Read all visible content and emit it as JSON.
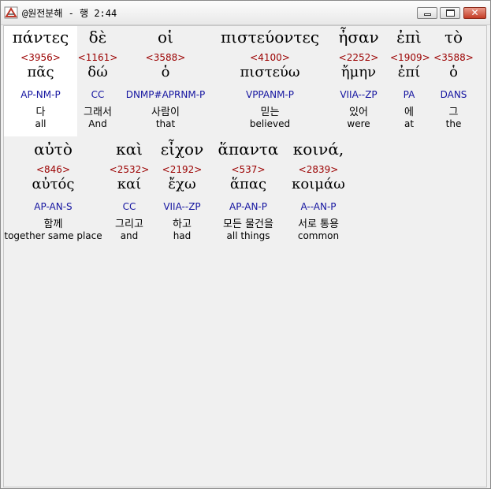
{
  "window": {
    "title": "@원전분해 - 행 2:44",
    "buttons": {
      "minimize": "_",
      "maximize": "□",
      "close": "✕"
    },
    "icon": "book-pen-icon"
  },
  "words": [
    {
      "greek": "πάντες",
      "strong": "<3956>",
      "lemma": "πᾶς",
      "morph": "AP-NM-P",
      "korean": "다",
      "english": "all",
      "selected": true
    },
    {
      "greek": "δὲ",
      "strong": "<1161>",
      "lemma": "δώ",
      "morph": "CC",
      "korean": "그래서",
      "english": "And"
    },
    {
      "greek": "οἱ",
      "strong": "<3588>",
      "lemma": "ὁ",
      "morph": "DNMP#APRNM-P",
      "korean": "사람이",
      "english": "that"
    },
    {
      "greek": "πιστεύοντες",
      "strong": "<4100>",
      "lemma": "πιστεύω",
      "morph": "VPPANM-P",
      "korean": "믿는",
      "english": "believed"
    },
    {
      "greek": "ἦσαν",
      "strong": "<2252>",
      "lemma": "ἤμην",
      "morph": "VIIA--ZP",
      "korean": "있어",
      "english": "were"
    },
    {
      "greek": "ἐπὶ",
      "strong": "<1909>",
      "lemma": "ἐπί",
      "morph": "PA",
      "korean": "에",
      "english": "at"
    },
    {
      "greek": "τὸ",
      "strong": "<3588>",
      "lemma": "ὁ",
      "morph": "DANS",
      "korean": "그",
      "english": "the"
    },
    {
      "greek": "αὐτὸ",
      "strong": "<846>",
      "lemma": "αὐτός",
      "morph": "AP-AN-S",
      "korean": "함께",
      "english": "together same place"
    },
    {
      "greek": "καὶ",
      "strong": "<2532>",
      "lemma": "καί",
      "morph": "CC",
      "korean": "그리고",
      "english": "and"
    },
    {
      "greek": "εἶχον",
      "strong": "<2192>",
      "lemma": "ἔχω",
      "morph": "VIIA--ZP",
      "korean": "하고",
      "english": "had"
    },
    {
      "greek": "ἅπαντα",
      "strong": "<537>",
      "lemma": "ἅπας",
      "morph": "AP-AN-P",
      "korean": "모든 물건을",
      "english": "all things"
    },
    {
      "greek": "κοινά,",
      "strong": "<2839>",
      "lemma": "κοιμάω",
      "morph": "A--AN-P",
      "korean": "서로 통용",
      "english": "common"
    }
  ]
}
